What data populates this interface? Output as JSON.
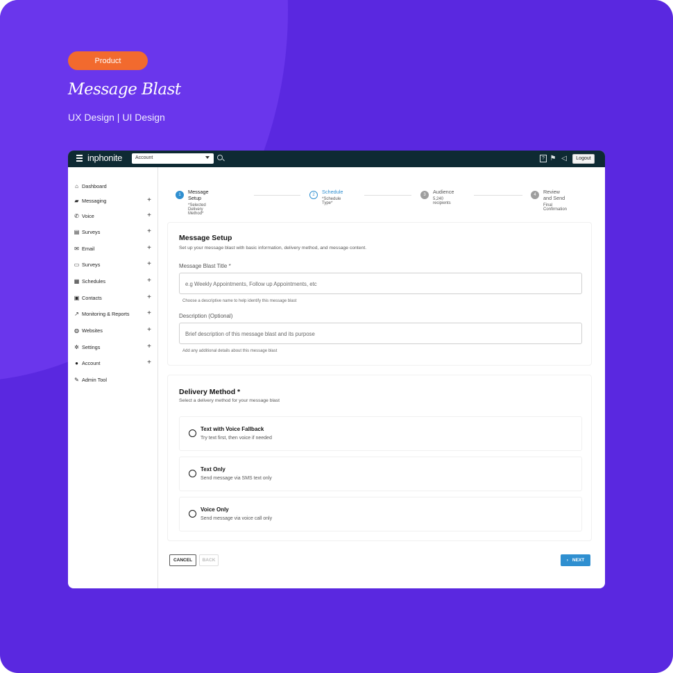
{
  "cover": {
    "tag": "Product",
    "title": "Message Blast",
    "subtitle": "UX Design | UI Design"
  },
  "topbar": {
    "logo": "inphonite",
    "account_select": "Account",
    "logout_label": "Logout",
    "icons": [
      "help-icon",
      "flag-icon",
      "megaphone-icon"
    ]
  },
  "sidebar": {
    "items": [
      {
        "label": "Dashboard",
        "icon": "home-icon",
        "glyph": "⌂",
        "expandable": false
      },
      {
        "label": "Messaging",
        "icon": "chat-icon",
        "glyph": "▰",
        "expandable": true
      },
      {
        "label": "Voice",
        "icon": "phone-icon",
        "glyph": "✆",
        "expandable": true
      },
      {
        "label": "Surveys",
        "icon": "clipboard-icon",
        "glyph": "▤",
        "expandable": true
      },
      {
        "label": "Email",
        "icon": "mail-icon",
        "glyph": "✉",
        "expandable": true
      },
      {
        "label": "Surveys",
        "icon": "folder-icon",
        "glyph": "▭",
        "expandable": true
      },
      {
        "label": "Schedules",
        "icon": "calendar-icon",
        "glyph": "▦",
        "expandable": true
      },
      {
        "label": "Contacts",
        "icon": "contact-icon",
        "glyph": "▣",
        "expandable": true
      },
      {
        "label": "Monitoring & Reports",
        "icon": "chart-icon",
        "glyph": "↗",
        "expandable": true
      },
      {
        "label": "Websites",
        "icon": "globe-icon",
        "glyph": "◍",
        "expandable": true
      },
      {
        "label": "Settings",
        "icon": "gear-icon",
        "glyph": "✲",
        "expandable": true
      },
      {
        "label": "Account",
        "icon": "user-icon",
        "glyph": "●",
        "expandable": true
      },
      {
        "label": "Admin Tool",
        "icon": "wrench-icon",
        "glyph": "✎",
        "expandable": false
      }
    ]
  },
  "stepper": [
    {
      "num": "1",
      "title": "Message Setup",
      "sub": "*Selected Delivery Method*",
      "state": "active"
    },
    {
      "num": "2",
      "title": "Schedule",
      "sub": "*Schedule Type*",
      "state": "current"
    },
    {
      "num": "3",
      "title": "Audience",
      "sub": "5,240 recipients",
      "state": "off"
    },
    {
      "num": "4",
      "title": "Review and Send",
      "sub": "Final Confirmation",
      "state": "off"
    }
  ],
  "setup": {
    "heading": "Message Setup",
    "description": "Set up your message blast with basic information, delivery method, and message content.",
    "title_label": "Message Blast Title *",
    "title_placeholder": "e.g Weekly Appointments, Follow up Appointments, etc",
    "title_hint": "Choose a descriptive name to help identify this message blast",
    "desc_label": "Description (Optional)",
    "desc_placeholder": "Brief description of this message blast and its purpose",
    "desc_hint": "Add any additional details about this message blast"
  },
  "delivery": {
    "heading": "Delivery Method *",
    "description": "Select a delivery method for your message blast",
    "options": [
      {
        "title": "Text with Voice Fallback",
        "sub": "Try text first, then voice if needed"
      },
      {
        "title": "Text Only",
        "sub": "Send message via SMS text only"
      },
      {
        "title": "Voice Only",
        "sub": "Send message via voice call only"
      }
    ]
  },
  "footer": {
    "cancel_label": "CANCEL",
    "back_label": "BACK",
    "next_label": "NEXT"
  }
}
